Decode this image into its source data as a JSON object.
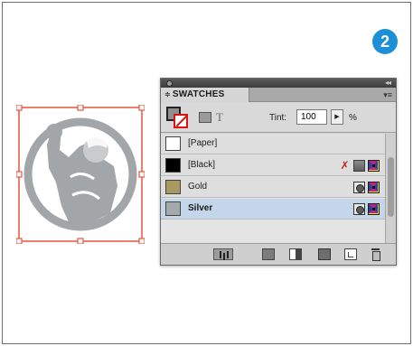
{
  "step_badge": "2",
  "panel": {
    "tab_label": "SWATCHES",
    "tab_arrows": "≑",
    "menu_icon": "▾≡",
    "tint_label": "Tint:",
    "tint_value": "100",
    "tint_arrow": "▶",
    "tint_unit": "%",
    "text_toggle": "T",
    "swatches": [
      {
        "name": "[Paper]",
        "color": "#ffffff"
      },
      {
        "name": "[Black]",
        "color": "#000000"
      },
      {
        "name": "Gold",
        "color": "#a99a63"
      },
      {
        "name": "Silver",
        "color": "#a6a9ab",
        "selected": true
      }
    ]
  },
  "colors": {
    "accent_badge": "#1c8fd6",
    "selection_frame": "#e8553d",
    "artwork_gray": "#a3a6a8",
    "selected_row": "#c4d7ea"
  }
}
